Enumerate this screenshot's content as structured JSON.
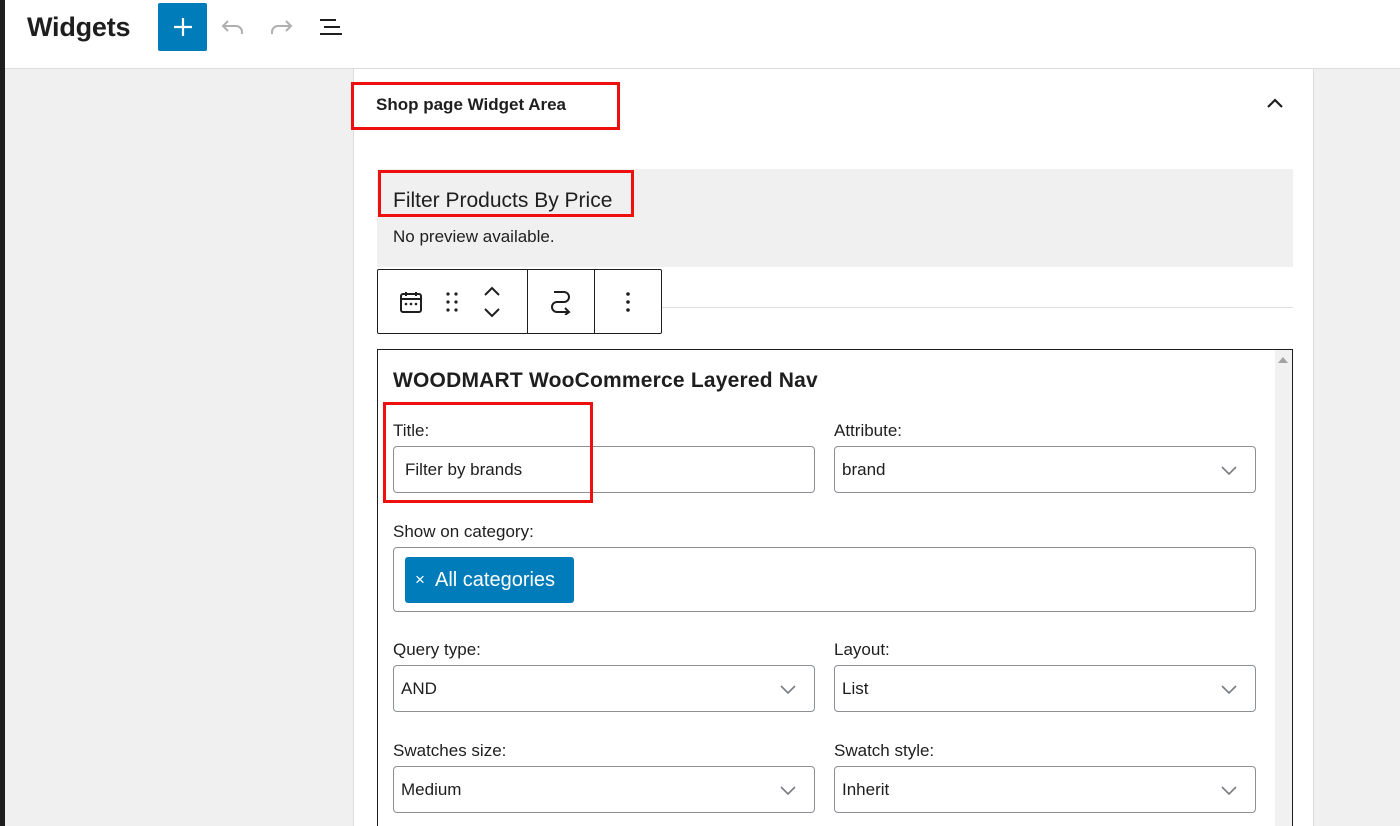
{
  "header": {
    "title": "Widgets",
    "add_button_label": "+",
    "icons": [
      "plus-icon",
      "undo-icon",
      "redo-icon",
      "list-view-icon"
    ]
  },
  "area": {
    "title": "Shop page Widget Area",
    "toggle_icon": "chevron-up-icon"
  },
  "preview": {
    "title": "Filter Products By Price",
    "note": "No preview available."
  },
  "toolbar": {
    "icons": [
      "calendar-icon",
      "drag-handle-icon",
      "move-up-icon",
      "move-down-icon",
      "transform-icon",
      "more-options-icon"
    ]
  },
  "form": {
    "heading": "WOODMART WooCommerce Layered Nav",
    "title_label": "Title:",
    "title_value": "Filter by brands",
    "attribute_label": "Attribute:",
    "attribute_value": "brand",
    "category_label": "Show on category:",
    "category_tag": "All categories",
    "category_tag_remove": "×",
    "query_type_label": "Query type:",
    "query_type_value": "AND",
    "layout_label": "Layout:",
    "layout_value": "List",
    "swatches_size_label": "Swatches size:",
    "swatches_size_value": "Medium",
    "swatch_style_label": "Swatch style:",
    "swatch_style_value": "Inherit"
  },
  "colors": {
    "accent": "#007cba",
    "highlight_box": "#ee0f0f",
    "preview_bg": "#f0f0f0"
  }
}
